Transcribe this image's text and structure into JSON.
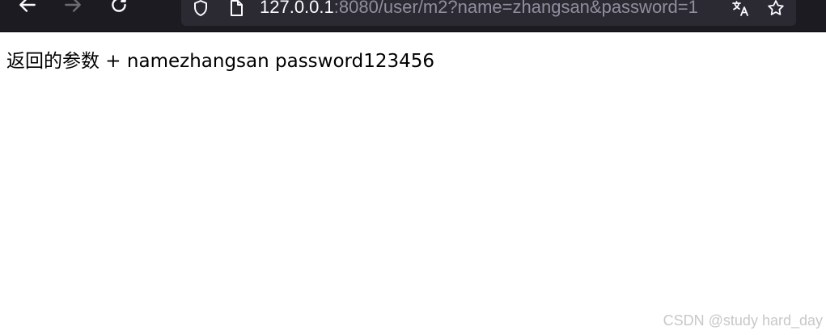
{
  "toolbar": {
    "back_icon": "arrow-left-icon",
    "forward_icon": "arrow-right-icon",
    "reload_icon": "reload-icon",
    "shield_icon": "shield-icon",
    "page_icon": "page-icon",
    "translate_icon": "translate-icon",
    "star_icon": "star-icon",
    "url_host": "127.0.0.1",
    "url_rest": ":8080/user/m2?name=zhangsan&password=1"
  },
  "page": {
    "text": "返回的参数 + namezhangsan password123456"
  },
  "watermark": "CSDN @study hard_day",
  "colors": {
    "toolbar_bg": "#1c1b22",
    "urlbar_bg": "#2b2a33",
    "url_host": "#fbfbfe",
    "url_rest": "#8f8f9d"
  }
}
